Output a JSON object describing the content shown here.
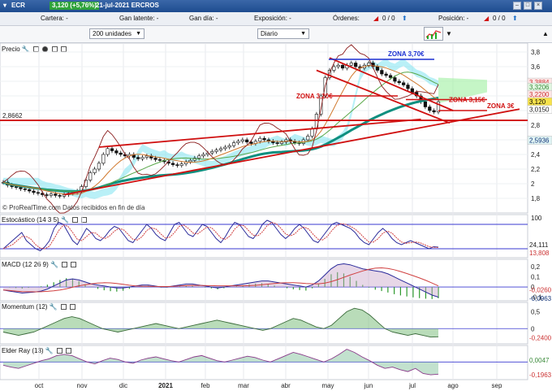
{
  "window": {
    "ticker": "ECR",
    "price_change": "3,120 (+5,76%)",
    "title_rest": "21-jul-2021 ERCROS"
  },
  "info": {
    "cartera": "Cartera: -",
    "latente": "Gan latente: -",
    "dia": "Gan día: -",
    "exposicion": "Exposición: -",
    "ordenes_label": "Órdenes:",
    "ordenes_val": "0 / 0",
    "posicion": "Posición: -",
    "posicion_val": "0 / 0"
  },
  "controls": {
    "units": "200 unidades",
    "period": "Diario"
  },
  "panels": {
    "price": "Precio",
    "stoch": "Estocástico (14 3 5)",
    "macd": "MACD (12 26 9)",
    "momentum": "Momentum (12)",
    "elder": "Elder Ray (13)"
  },
  "credit": "© ProRealTime.com  Datos recibidos en fin de día",
  "chart_data": {
    "type": "candlestick",
    "x_ticks": [
      "oct",
      "nov",
      "dic",
      "2021",
      "feb",
      "mar",
      "abr",
      "may",
      "jun",
      "jul",
      "ago",
      "sep"
    ],
    "price_axis": {
      "ylim": [
        1.6,
        3.9
      ],
      "ticks": [
        "1,8",
        "2",
        "2,2",
        "2,4",
        "2,6",
        "2,8",
        "3",
        "3,2",
        "3,4",
        "3,6",
        "3,8"
      ]
    },
    "price_labels": {
      "last": "3,120",
      "l1": "3,3884",
      "l2": "3,3206",
      "l3": "3,2200",
      "l4": "3,0150",
      "l5": "2,5936",
      "left_level": "2,8662"
    },
    "level_2_8662": 2.8662,
    "zones": [
      {
        "label": "ZONA 3,70€",
        "value": 3.7,
        "color": "#1a2fd1"
      },
      {
        "label": "ZONA 3,20€",
        "value": 3.2,
        "color": "#d01010"
      },
      {
        "label": "ZONA 3,15€",
        "value": 3.15,
        "color": "#d01010"
      },
      {
        "label": "ZONA 3€",
        "value": 3.0,
        "color": "#d01010"
      }
    ],
    "close": [
      2.02,
      1.98,
      1.96,
      1.95,
      1.93,
      1.92,
      1.9,
      1.88,
      1.87,
      1.85,
      1.84,
      1.86,
      1.84,
      1.83,
      1.85,
      1.87,
      1.88,
      1.9,
      1.96,
      2.05,
      2.15,
      2.2,
      2.28,
      2.4,
      2.48,
      2.45,
      2.42,
      2.4,
      2.38,
      2.4,
      2.36,
      2.34,
      2.36,
      2.38,
      2.35,
      2.33,
      2.32,
      2.3,
      2.28,
      2.26,
      2.25,
      2.27,
      2.3,
      2.32,
      2.35,
      2.38,
      2.4,
      2.42,
      2.44,
      2.46,
      2.48,
      2.5,
      2.52,
      2.56,
      2.58,
      2.6,
      2.57,
      2.55,
      2.58,
      2.62,
      2.6,
      2.58,
      2.56,
      2.55,
      2.57,
      2.6,
      2.58,
      2.56,
      2.55,
      2.6,
      2.65,
      2.75,
      2.95,
      3.2,
      3.45,
      3.55,
      3.6,
      3.62,
      3.58,
      3.62,
      3.65,
      3.6,
      3.58,
      3.62,
      3.65,
      3.6,
      3.55,
      3.5,
      3.48,
      3.45,
      3.4,
      3.38,
      3.35,
      3.3,
      3.25,
      3.2,
      3.12,
      3.05,
      3.0,
      2.98,
      3.12
    ],
    "stochastic": {
      "upper": 100,
      "lower": 0,
      "labels": [
        "100",
        "24,111",
        "13,808"
      ],
      "k": [
        20,
        30,
        40,
        50,
        60,
        40,
        30,
        20,
        15,
        25,
        40,
        70,
        85,
        80,
        60,
        40,
        30,
        50,
        70,
        60,
        45,
        40,
        50,
        65,
        75,
        70,
        55,
        40,
        35,
        50,
        65,
        80,
        70,
        55,
        45,
        40,
        60,
        80,
        85,
        70,
        55,
        50,
        65,
        80,
        75,
        60,
        45,
        35,
        50,
        70,
        85,
        80,
        65,
        50,
        45,
        60,
        80,
        90,
        85,
        70,
        55,
        45,
        55,
        70,
        80,
        70,
        55,
        40,
        35,
        50,
        65,
        80,
        85,
        80,
        75,
        70,
        60,
        45,
        35,
        30,
        45,
        60,
        70,
        60,
        45,
        35,
        30,
        35,
        40,
        35,
        30,
        25,
        20,
        25,
        24
      ]
    },
    "macd": {
      "labels": [
        "0,2",
        "0,1",
        "0",
        "-0,1",
        "-0,0260",
        "-0,0963"
      ],
      "line": [
        -0.03,
        -0.04,
        -0.05,
        -0.06,
        -0.055,
        -0.05,
        -0.04,
        -0.02,
        0.01,
        0.04,
        0.07,
        0.08,
        0.07,
        0.05,
        0.03,
        0.02,
        0.01,
        0.0,
        -0.01,
        -0.01,
        0.0,
        0.01,
        0.02,
        0.02,
        0.01,
        0.0,
        0.0,
        0.01,
        0.02,
        0.03,
        0.03,
        0.02,
        0.01,
        0.0,
        -0.01,
        0.0,
        0.01,
        0.02,
        0.03,
        0.04,
        0.05,
        0.06,
        0.06,
        0.05,
        0.04,
        0.03,
        0.02,
        0.01,
        0.0,
        0.02,
        0.06,
        0.12,
        0.18,
        0.22,
        0.23,
        0.22,
        0.2,
        0.18,
        0.17,
        0.16,
        0.15,
        0.13,
        0.1,
        0.07,
        0.04,
        0.01,
        -0.02,
        -0.05,
        -0.08,
        -0.1
      ]
    },
    "momentum": {
      "labels": [
        "0,5",
        "0",
        "-0,2400"
      ],
      "line": [
        -0.1,
        -0.15,
        -0.2,
        -0.15,
        -0.1,
        0.0,
        0.1,
        0.2,
        0.3,
        0.35,
        0.3,
        0.2,
        0.1,
        0.0,
        -0.05,
        -0.1,
        -0.05,
        0.0,
        0.05,
        0.1,
        0.15,
        0.1,
        0.05,
        0.0,
        0.05,
        0.1,
        0.15,
        0.2,
        0.25,
        0.2,
        0.15,
        0.1,
        0.05,
        0.0,
        -0.05,
        0.0,
        0.1,
        0.2,
        0.3,
        0.25,
        0.15,
        0.05,
        0.0,
        0.1,
        0.3,
        0.5,
        0.6,
        0.55,
        0.4,
        0.2,
        0.0,
        -0.1,
        -0.15,
        -0.2,
        -0.15,
        -0.2,
        -0.25,
        -0.24
      ]
    },
    "elder_ray": {
      "labels": [
        "0,0047",
        "-0,1963"
      ],
      "line": [
        -0.05,
        -0.08,
        -0.1,
        -0.06,
        -0.02,
        0.02,
        0.05,
        0.1,
        0.12,
        0.1,
        0.05,
        0.0,
        -0.03,
        0.02,
        0.06,
        0.04,
        0.0,
        -0.02,
        0.03,
        0.06,
        0.08,
        0.05,
        0.02,
        0.0,
        0.04,
        0.08,
        0.1,
        0.06,
        0.02,
        0.0,
        0.03,
        0.06,
        0.09,
        0.07,
        0.03,
        0.0,
        0.05,
        0.1,
        0.15,
        0.12,
        0.08,
        0.04,
        0.0,
        0.05,
        0.12,
        0.2,
        0.15,
        0.08,
        0.02,
        -0.05,
        -0.1,
        -0.08,
        -0.12,
        -0.15,
        -0.1,
        -0.18,
        -0.2,
        -0.19
      ]
    }
  }
}
